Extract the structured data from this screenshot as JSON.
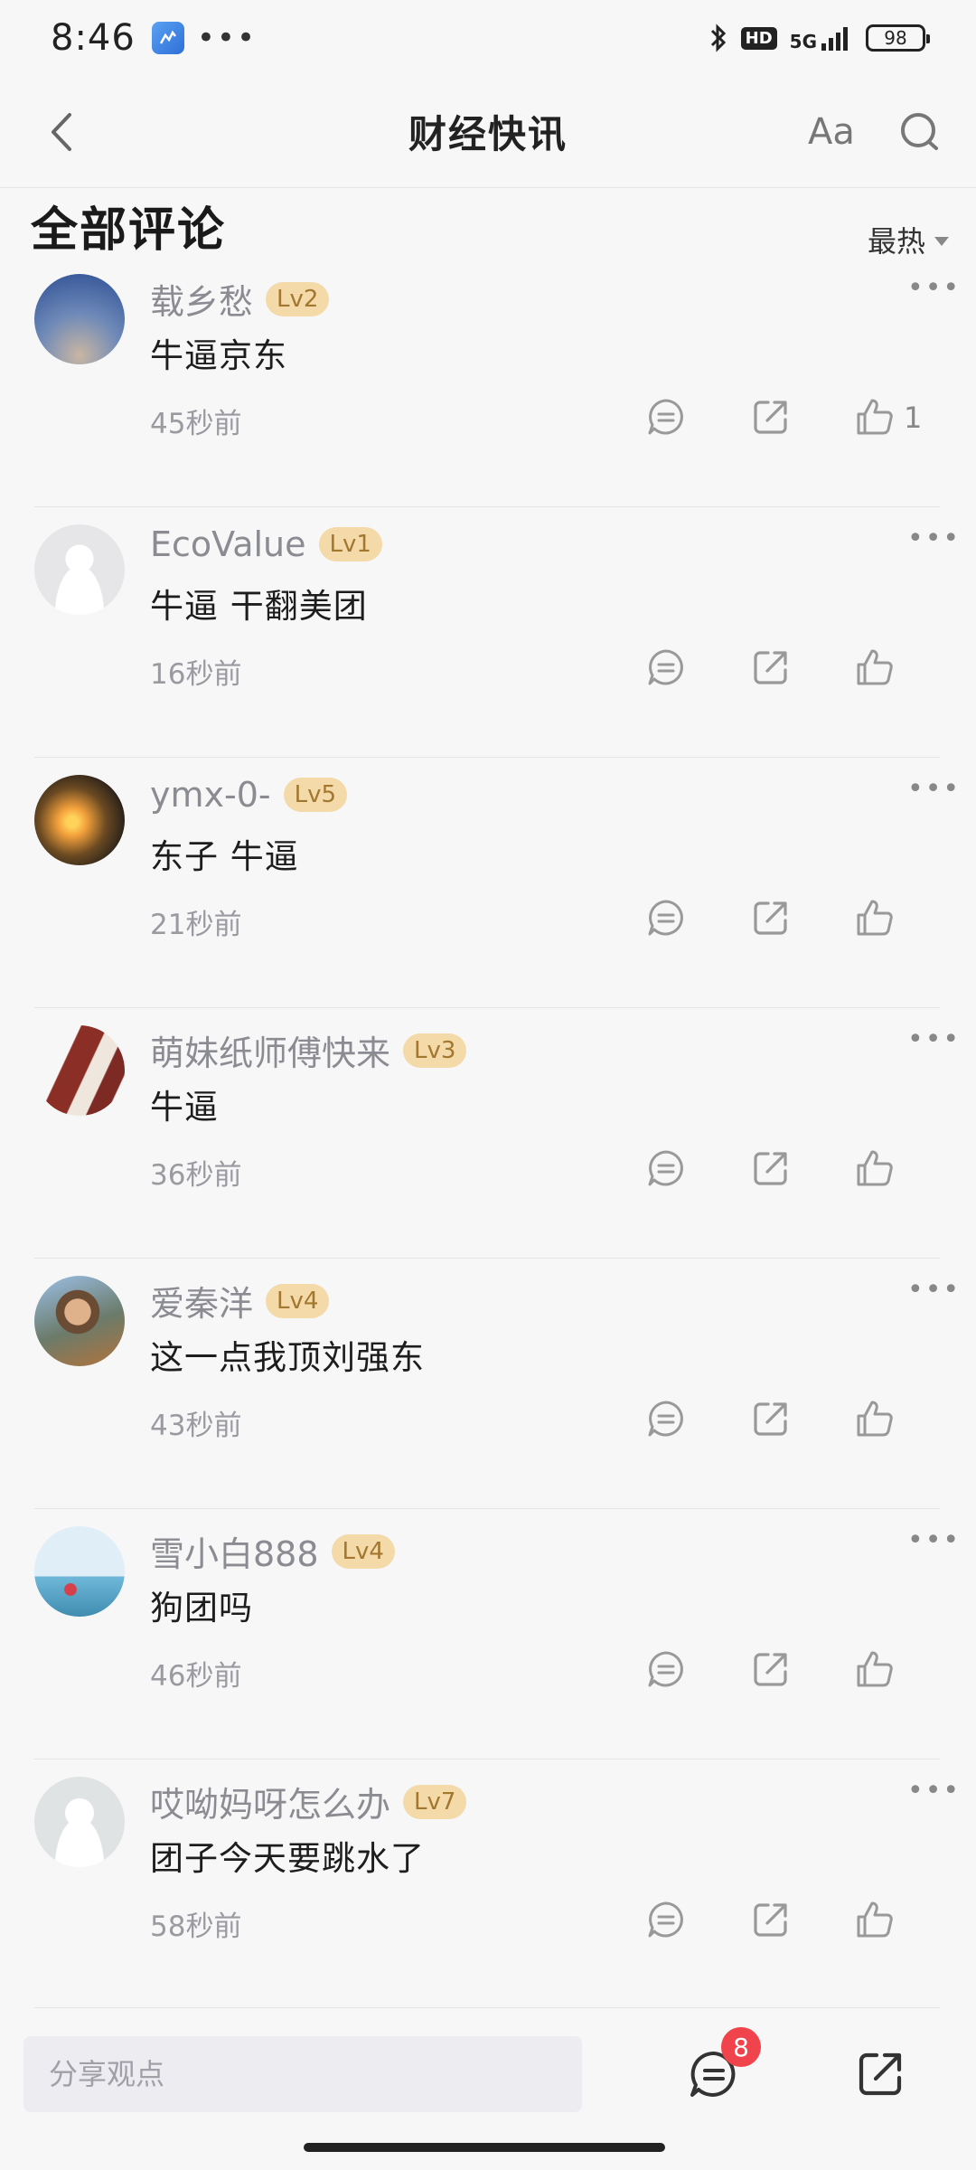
{
  "status_bar": {
    "time": "8:46",
    "network": "5G",
    "hd": "HD",
    "battery": "98"
  },
  "nav": {
    "title": "财经快讯",
    "font_button": "Aa"
  },
  "section": {
    "title": "全部评论",
    "sort_label": "最热"
  },
  "comments": [
    {
      "name": "载乡愁",
      "level": "Lv2",
      "text": "牛逼京东",
      "time": "45秒前",
      "likes": "1"
    },
    {
      "name": "EcoValue",
      "level": "Lv1",
      "text": "牛逼 干翻美团",
      "time": "16秒前",
      "likes": ""
    },
    {
      "name": "ymx-0-",
      "level": "Lv5",
      "text": "东子 牛逼",
      "time": "21秒前",
      "likes": ""
    },
    {
      "name": "萌妹纸师傅快来",
      "level": "Lv3",
      "text": "牛逼",
      "time": "36秒前",
      "likes": ""
    },
    {
      "name": "爱秦洋",
      "level": "Lv4",
      "text": "这一点我顶刘强东",
      "time": "43秒前",
      "likes": ""
    },
    {
      "name": "雪小白888",
      "level": "Lv4",
      "text": "狗团吗",
      "time": "46秒前",
      "likes": ""
    },
    {
      "name": "哎呦妈呀怎么办",
      "level": "Lv7",
      "text": "团子今天要跳水了",
      "time": "58秒前",
      "likes": ""
    }
  ],
  "bottom_bar": {
    "input_placeholder": "分享观点",
    "comment_count": "8"
  },
  "icons": {
    "back": "chevron-left-icon",
    "search": "search-icon",
    "reply": "comment-icon",
    "share": "share-icon",
    "like": "thumbs-up-icon",
    "more": "more-icon"
  },
  "colors": {
    "badge_bg": "#f4d9a9",
    "badge_text": "#a2772f",
    "notify_badge": "#f0434b"
  }
}
